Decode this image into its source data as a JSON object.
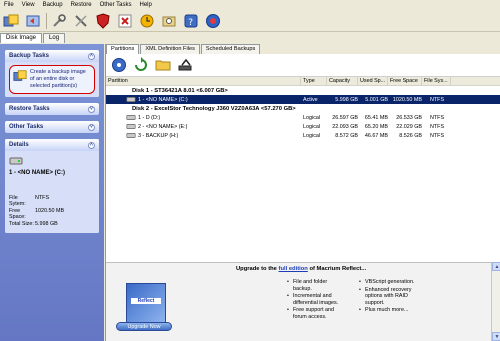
{
  "menu": [
    "File",
    "View",
    "Backup",
    "Restore",
    "Other Tasks",
    "Help"
  ],
  "toolbar_icons": [
    "backup-image-icon",
    "restore-icon",
    "settings-icon",
    "tools-icon",
    "shield-icon",
    "close-icon",
    "schedule-icon",
    "browse-image-icon",
    "help-icon",
    "update-icon"
  ],
  "main_tabs": [
    "Disk Image",
    "Log"
  ],
  "sidebar": {
    "backup_tasks": {
      "title": "Backup Tasks",
      "item": "Create a backup image of an entire disk or selected partition(s)"
    },
    "restore_tasks": {
      "title": "Restore Tasks"
    },
    "other_tasks": {
      "title": "Other Tasks"
    },
    "details": {
      "title": "Details",
      "name": "1 - <NO NAME> (C:)",
      "file_system_label": "File Sytem:",
      "file_system": "NTFS",
      "free_space_label": "Free Space:",
      "free_space": "1020.50 MB",
      "total_size_label": "Total Size:",
      "total_size": "5.998 GB"
    }
  },
  "sub_tabs": [
    "Partitions",
    "XML Definition Files",
    "Scheduled Backups"
  ],
  "columns": [
    "Partition",
    "Type",
    "Capacity",
    "Used Sp...",
    "Free Space",
    "File Sys..."
  ],
  "disks": [
    {
      "label": "Disk 1 - ST36421A 8.01  <6.007 GB>",
      "partitions": [
        {
          "name": "1 - <NO NAME> (C:)",
          "type": "Active",
          "capacity": "5.998 GB",
          "used": "5.001 GB",
          "free": "1020.50 MB",
          "fs": "NTFS",
          "selected": true
        }
      ]
    },
    {
      "label": "Disk 2 - ExcelStor Technology J360 V2Z0A63A  <57.270 GB>",
      "partitions": [
        {
          "name": "1 - D (D:)",
          "type": "Logical",
          "capacity": "26.597 GB",
          "used": "65.41 MB",
          "free": "26.533 GB",
          "fs": "NTFS",
          "selected": false
        },
        {
          "name": "2 - <NO NAME> (E:)",
          "type": "Logical",
          "capacity": "22.093 GB",
          "used": "65.20 MB",
          "free": "22.029 GB",
          "fs": "NTFS",
          "selected": false
        },
        {
          "name": "3 - BACKUP (H:)",
          "type": "Logical",
          "capacity": "8.572 GB",
          "used": "46.67 MB",
          "free": "8.526 GB",
          "fs": "NTFS",
          "selected": false
        }
      ]
    }
  ],
  "ad": {
    "title_prefix": "Upgrade to the ",
    "title_link": "full edition",
    "title_suffix": " of Macrium Reflect...",
    "box_label": "Reflect",
    "button": "Upgrade Now",
    "col1": [
      "File and folder backup.",
      "Incremental and differential images.",
      "Free support and forum access."
    ],
    "col2": [
      "VBScript generation.",
      "Enhanced recovery options with RAID support.",
      "Plus much more..."
    ]
  }
}
